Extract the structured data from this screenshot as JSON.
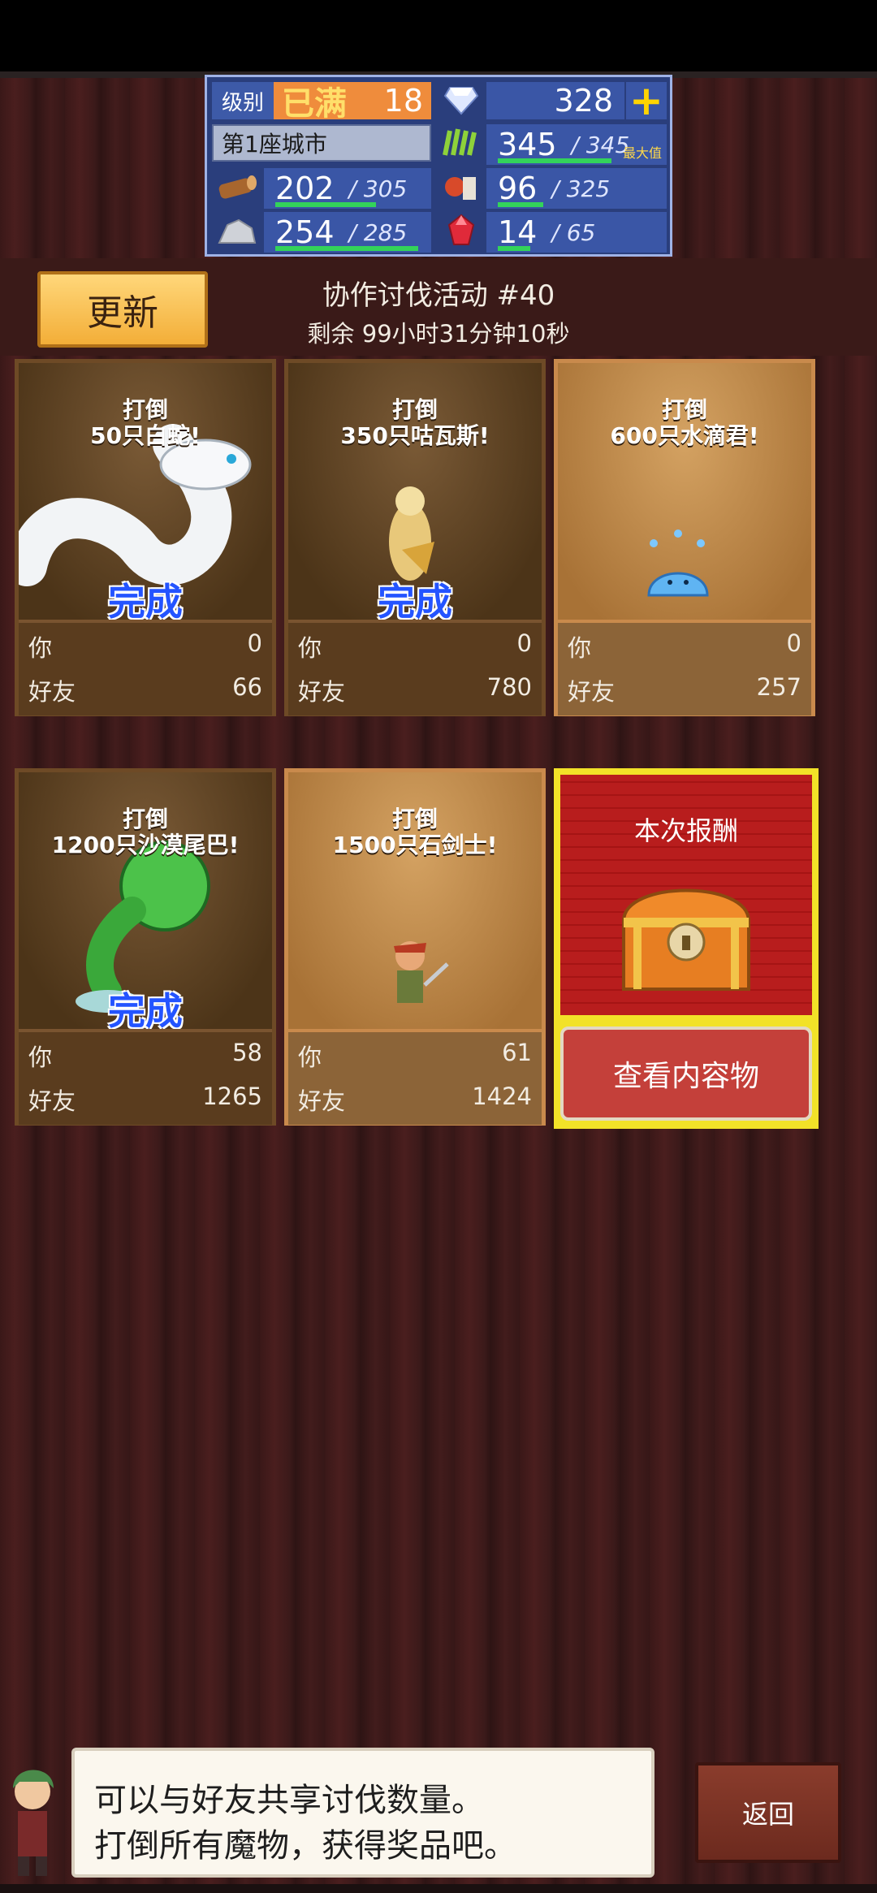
{
  "status": {
    "level_label": "级别",
    "level_max_text": "已满",
    "level": "18",
    "gems": "328",
    "plus_label": "+",
    "city": "第1座城市",
    "wood": "202",
    "wood_cap": "/ 305",
    "stone": "254",
    "stone_cap": "/ 285",
    "grass": "345",
    "grass_cap": "/ 345",
    "grass_max_tag": "最大值",
    "food": "96",
    "food_cap": "/ 325",
    "ruby": "14",
    "ruby_cap": "/ 65"
  },
  "header": {
    "refresh_label": "更新",
    "title": "协作讨伐活动 #40",
    "timer": "剩余 99小时31分钟10秒"
  },
  "labels": {
    "you": "你",
    "friends": "好友",
    "done": "完成"
  },
  "cards": [
    {
      "line1": "打倒",
      "line2": "50只白蛇!",
      "done": true,
      "you": "0",
      "friends": "66"
    },
    {
      "line1": "打倒",
      "line2": "350只咕瓦斯!",
      "done": true,
      "you": "0",
      "friends": "780"
    },
    {
      "line1": "打倒",
      "line2": "600只水滴君!",
      "done": false,
      "you": "0",
      "friends": "257"
    },
    {
      "line1": "打倒",
      "line2": "1200只沙漠尾巴!",
      "done": true,
      "you": "58",
      "friends": "1265"
    },
    {
      "line1": "打倒",
      "line2": "1500只石剑士!",
      "done": false,
      "you": "61",
      "friends": "1424"
    }
  ],
  "reward": {
    "title": "本次报酬",
    "button": "查看内容物"
  },
  "dialog": {
    "line1": "可以与好友共享讨伐数量。",
    "line2": "打倒所有魔物，获得奖品吧。"
  },
  "back_label": "返回"
}
